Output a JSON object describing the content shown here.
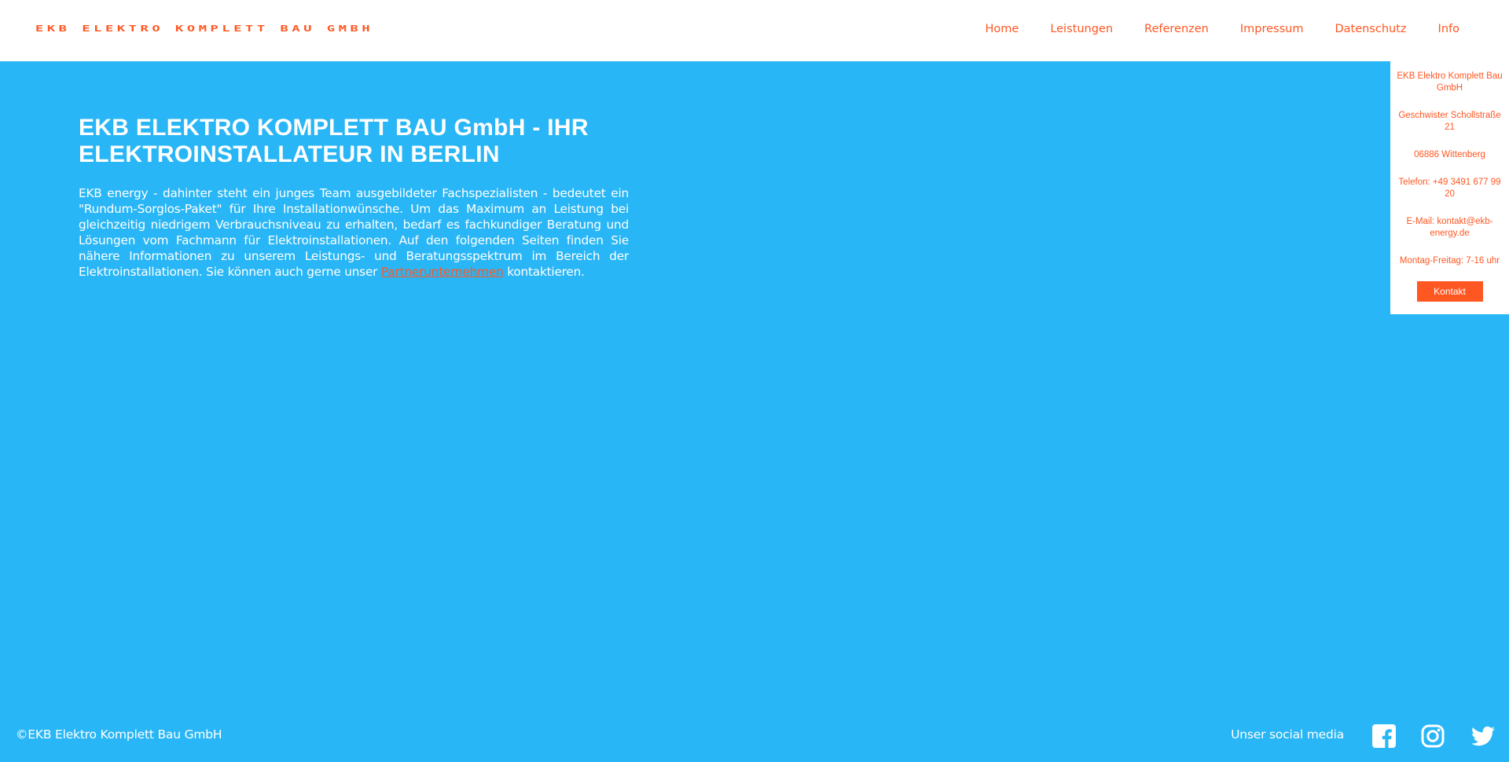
{
  "header": {
    "logo": "EKB ELEKTRO KOMPLETT BAU GMBH",
    "nav": [
      "Home",
      "Leistungen",
      "Referenzen",
      "Impressum",
      "Datenschutz",
      "Info"
    ]
  },
  "main": {
    "title": "EKB ELEKTRO KOMPLETT BAU GmbH - IHR ELEKTROINSTALLATEUR IN BERLIN",
    "intro_before": "EKB energy - dahinter steht ein junges Team ausgebildeter Fachspezialisten - bedeutet ein \"Rundum-Sorglos-Paket\" für Ihre Installationwünsche. Um das Maximum an Leistung bei gleichzeitig niedrigem Verbrauchsniveau zu erhalten, bedarf es fachkundiger Beratung und Lösungen vom Fachmann für Elektroinstallationen. Auf den folgenden Seiten finden Sie nähere Informationen zu unserem Leistungs- und Beratungsspektrum im Bereich der Elektroinstallationen. Sie können auch gerne unser ",
    "intro_link": "Partnerunternehmen",
    "intro_after": " kontaktieren."
  },
  "sidebar": {
    "company": "EKB Elektro Komplett Bau GmbH",
    "street": "Geschwister Schollstraße 21",
    "city": "06886 Wittenberg",
    "phone": "Telefon: +49 3491 677 99 20",
    "email": "E-Mail: kontakt@ekb-energy.de",
    "hours": "Montag-Freitag: 7-16 uhr",
    "button": "Kontakt"
  },
  "footer": {
    "copyright": "©EKB Elektro Komplett Bau GmbH",
    "social_label": "Unser social media",
    "icons": [
      "facebook-icon",
      "instagram-icon",
      "twitter-icon"
    ]
  },
  "colors": {
    "accent": "#ff5722",
    "background": "#29b6f6",
    "header": "#ffffff"
  }
}
